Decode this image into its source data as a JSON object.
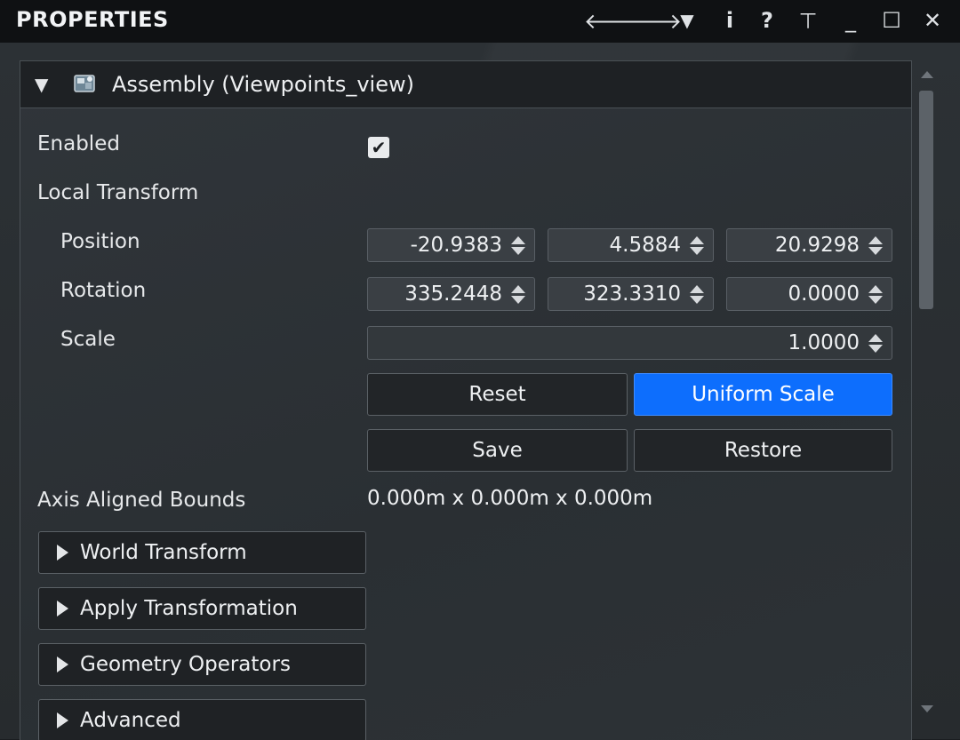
{
  "titlebar": {
    "title": "PROPERTIES",
    "icons": [
      "back-arrow-icon",
      "forward-arrow-icon",
      "dropdown-icon",
      "info-icon",
      "help-icon",
      "pin-icon",
      "minimize-icon",
      "maximize-icon",
      "close-icon"
    ],
    "glyphs": {
      "back": "🡐",
      "forward": "🡒",
      "dropdown": "▼",
      "info": "i",
      "help": "?",
      "pin": "⊥",
      "minimize": "_",
      "maximize": "☐",
      "close": "✕"
    }
  },
  "panel": {
    "title": "Assembly (Viewpoints_view)",
    "expanded_glyph": "▼",
    "enabled_label": "Enabled",
    "enabled_checked": true,
    "checkmark": "✔",
    "local_transform_label": "Local Transform",
    "position_label": "Position",
    "rotation_label": "Rotation",
    "scale_label": "Scale",
    "position": [
      "-20.9383",
      "4.5884",
      "20.9298"
    ],
    "rotation": [
      "335.2448",
      "323.3310",
      "0.0000"
    ],
    "scale": "1.0000",
    "buttons": {
      "reset": "Reset",
      "uniform_scale": "Uniform Scale",
      "save": "Save",
      "restore": "Restore"
    },
    "bounds_label": "Axis Aligned Bounds",
    "bounds_value": "0.000m x 0.000m x 0.000m",
    "sections": [
      "World Transform",
      "Apply Transformation",
      "Geometry Operators",
      "Advanced"
    ]
  },
  "colors": {
    "accent": "#0d6efd",
    "titlebar_bg": "#0f1113",
    "panel_bg": "#2c3135"
  }
}
